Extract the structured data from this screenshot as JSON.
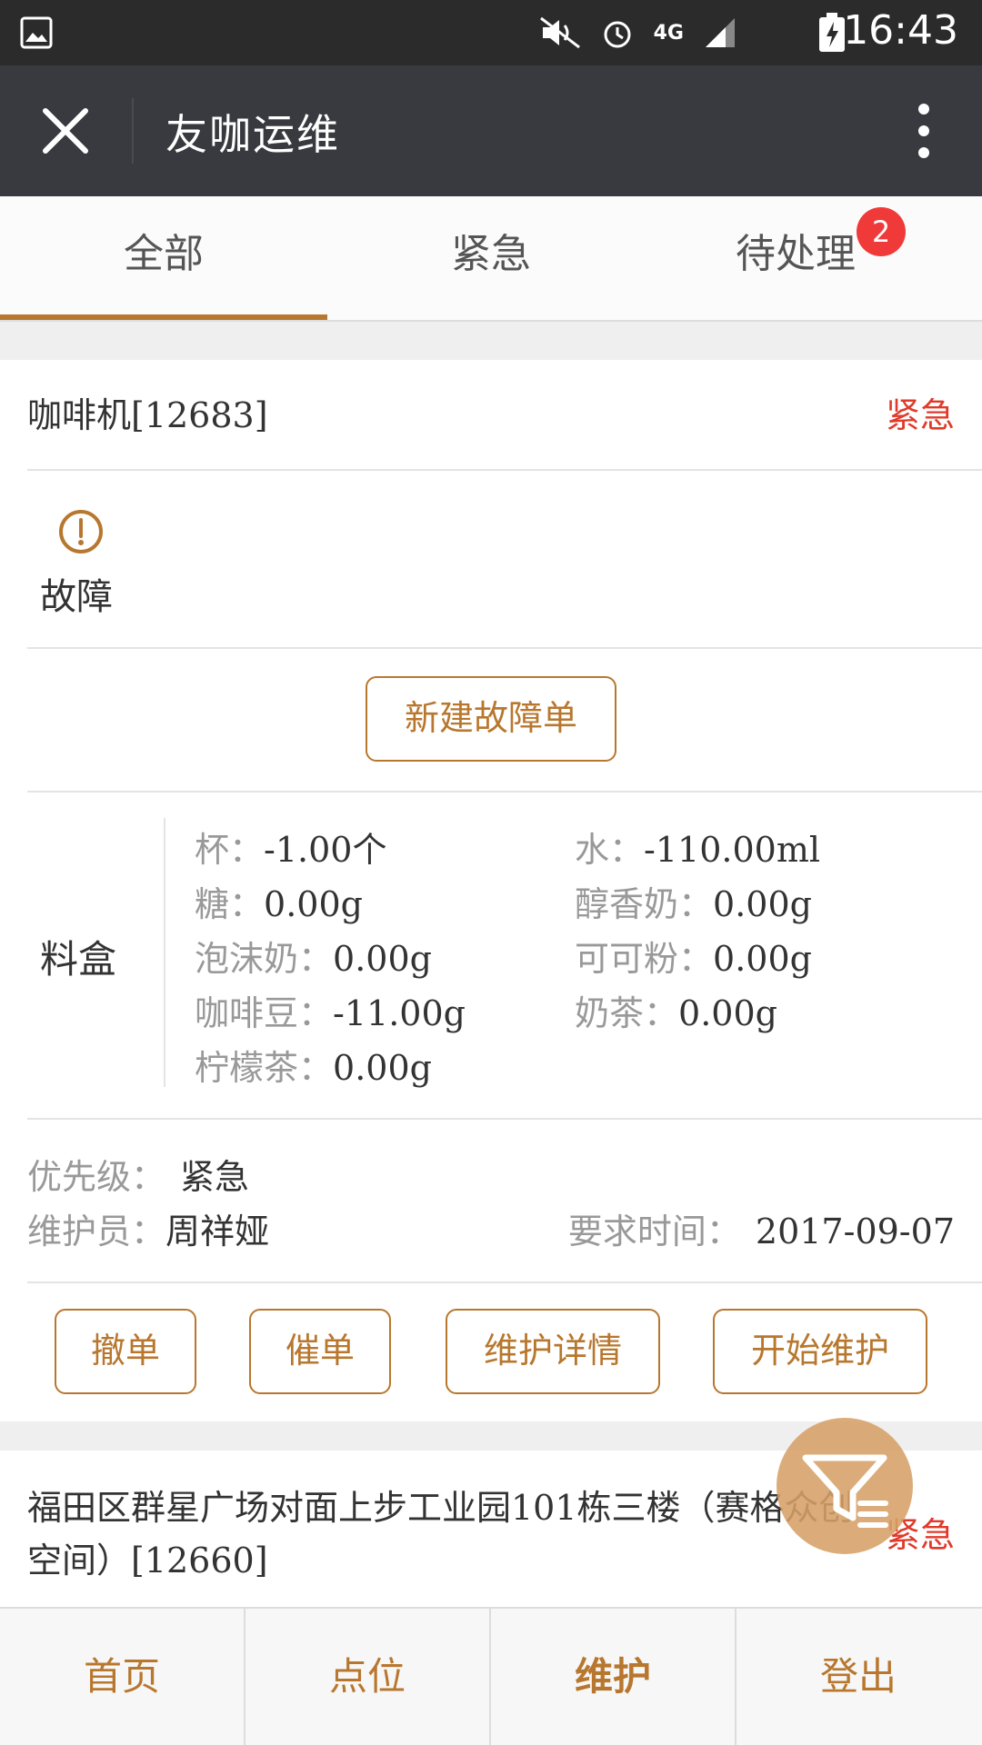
{
  "status_bar": {
    "time": "16:43",
    "network": "4G",
    "icons": [
      "gallery-icon",
      "mute-vibrate-icon",
      "alarm-icon",
      "signal-icon",
      "battery-charging-icon"
    ]
  },
  "app_bar": {
    "title": "友咖运维",
    "close_icon": "close-icon",
    "more_icon": "more-vertical-icon"
  },
  "tabs": [
    {
      "label": "全部",
      "active": true
    },
    {
      "label": "紧急",
      "active": false
    },
    {
      "label": "待处理",
      "active": false,
      "badge": "2"
    }
  ],
  "colors": {
    "accent": "#b8772e",
    "urgent": "#e03a2a",
    "badge": "#f03a3a",
    "app_bar": "#393a3f"
  },
  "order1": {
    "title": "咖啡机[12683]",
    "urgency": "紧急",
    "status_label": "故障",
    "new_fault_button": "新建故障单",
    "box_label": "料盒",
    "materials": [
      {
        "name": "杯：",
        "value": "-1.00个"
      },
      {
        "name": "水：",
        "value": "-110.00ml"
      },
      {
        "name": "糖：",
        "value": "0.00g"
      },
      {
        "name": "醇香奶：",
        "value": "0.00g"
      },
      {
        "name": "泡沫奶：",
        "value": "0.00g"
      },
      {
        "name": "可可粉：",
        "value": "0.00g"
      },
      {
        "name": "咖啡豆：",
        "value": "-11.00g"
      },
      {
        "name": "奶茶：",
        "value": "0.00g"
      },
      {
        "name": "柠檬茶：",
        "value": "0.00g"
      }
    ],
    "priority_label": "优先级：",
    "priority_value": "紧急",
    "maintainer_label": "维护员：",
    "maintainer_value": "周祥娅",
    "required_time_label": "要求时间：",
    "required_time_value": "2017-09-07",
    "actions": [
      "撤单",
      "催单",
      "维护详情",
      "开始维护"
    ]
  },
  "order2": {
    "title": "福田区群星广场对面上步工业园101栋三楼（赛格众创空间）[12660]",
    "urgency": "紧急"
  },
  "fab": {
    "icon": "filter-icon"
  },
  "bottom_nav": [
    {
      "label": "首页"
    },
    {
      "label": "点位"
    },
    {
      "label": "维护",
      "active": true
    },
    {
      "label": "登出"
    }
  ]
}
